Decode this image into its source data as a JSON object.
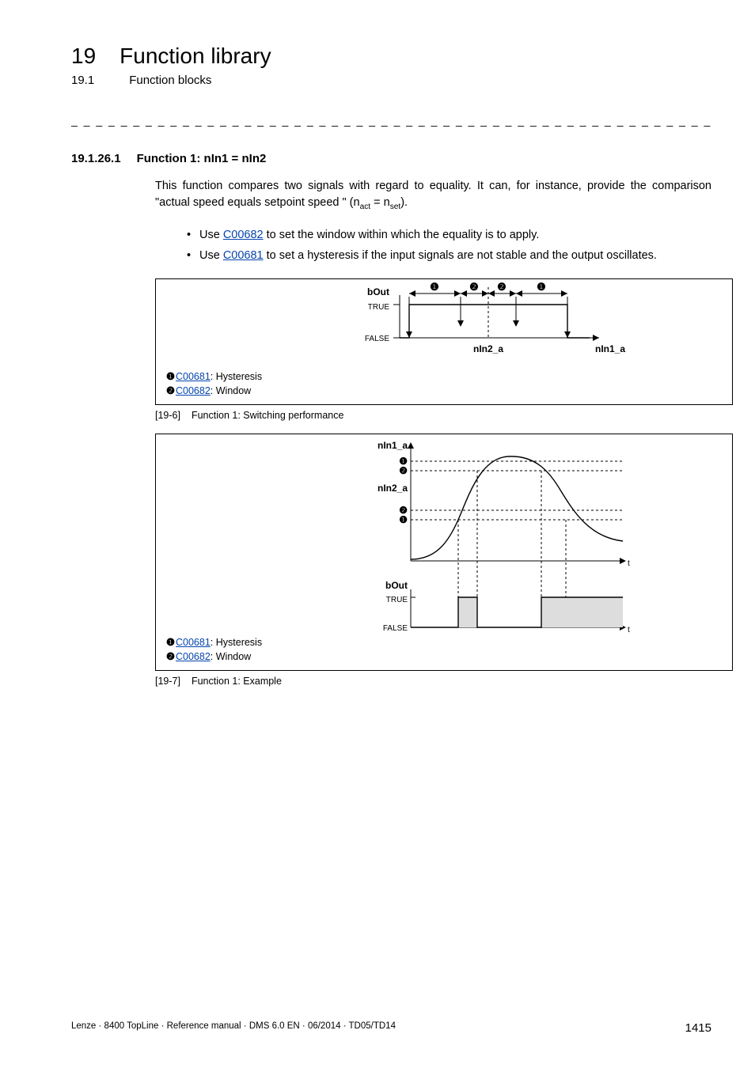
{
  "header": {
    "chapter_num": "19",
    "chapter_title": "Function library",
    "sub_num": "19.1",
    "sub_title": "Function blocks",
    "dashes": "_ _ _ _ _ _ _ _ _ _ _ _ _ _ _ _ _ _ _ _ _ _ _ _ _ _ _ _ _ _ _ _ _ _ _ _ _ _ _ _ _ _ _ _ _ _ _ _ _ _ _ _ _ _ _ _ _ _ _ _ _ _ _ _"
  },
  "section": {
    "num": "19.1.26.1",
    "title": "Function 1: nIn1 = nIn2"
  },
  "para_pre": "This function compares two signals with regard to equality. It can, for instance, provide the comparison \"actual speed equals setpoint speed \" (n",
  "para_sub1": "act",
  "para_mid": " = n",
  "para_sub2": "set",
  "para_post": ").",
  "bullets": {
    "b0_pre": "Use ",
    "b0_link": "C00682",
    "b0_post": " to set the window within which the equality is to apply.",
    "b1_pre": "Use ",
    "b1_link": "C00681",
    "b1_post": " to set a hysteresis if the input signals are not stable and the output oscillates."
  },
  "fig1": {
    "bout": "bOut",
    "true": "TRUE",
    "false": "FALSE",
    "nin2a": "nIn2_a",
    "nin1a": "nIn1_a",
    "circ1": "❶",
    "circ2": "❷"
  },
  "legend": {
    "l1_pre": "❶ ",
    "l1_link": "C00681",
    "l1_post": ": Hysteresis",
    "l2_pre": "❷ ",
    "l2_link": "C00682",
    "l2_post": ": Window"
  },
  "caption1": {
    "tag": "[19-6]",
    "text": "Function 1: Switching performance"
  },
  "fig2": {
    "nin1a": "nIn1_a",
    "nin2a": "nIn2_a",
    "bout": "bOut",
    "true": "TRUE",
    "false": "FALSE",
    "t": "t",
    "circ1": "❶",
    "circ2": "❷"
  },
  "caption2": {
    "tag": "[19-7]",
    "text": "Function 1: Example"
  },
  "footer": {
    "left": "Lenze · 8400 TopLine · Reference manual · DMS 6.0 EN · 06/2014 · TD05/TD14",
    "page": "1415"
  }
}
